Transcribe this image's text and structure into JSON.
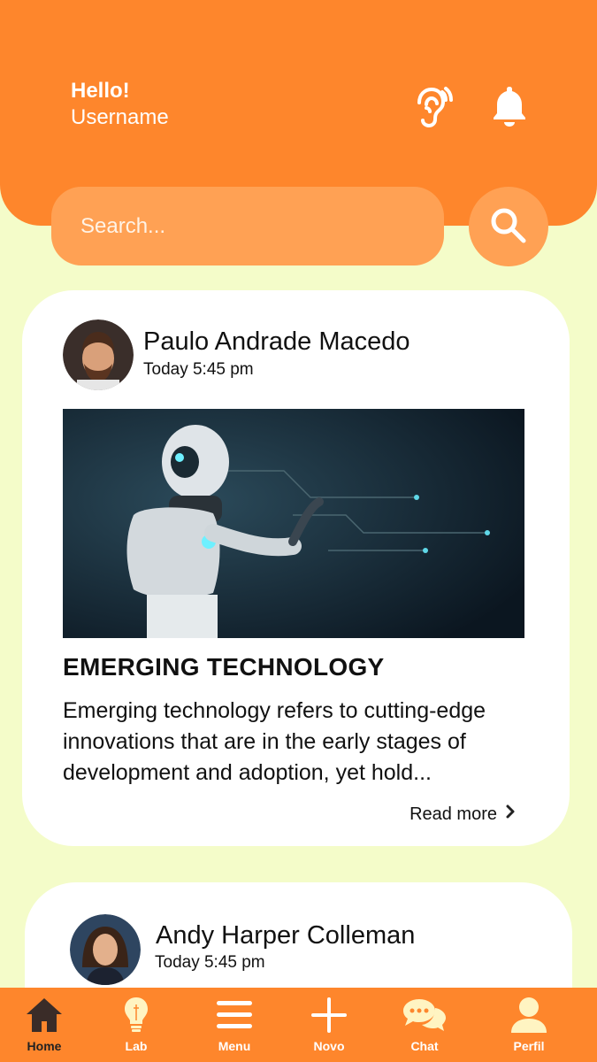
{
  "header": {
    "greeting": "Hello!",
    "username": "Username",
    "icons": [
      "ear-icon",
      "bell-icon"
    ]
  },
  "search": {
    "placeholder": "Search...",
    "icon": "search-icon"
  },
  "posts": [
    {
      "author": "Paulo Andrade Macedo",
      "time": "Today 5:45 pm",
      "title": "EMERGING TECHNOLOGY",
      "body": "Emerging technology refers to cutting-edge innovations that are in the early stages of development and adoption, yet hold...",
      "read_more": "Read more"
    },
    {
      "author": "Andy Harper Colleman",
      "time": "Today 5:45 pm"
    }
  ],
  "nav": [
    {
      "label": "Home",
      "icon": "home-icon",
      "active": true
    },
    {
      "label": "Lab",
      "icon": "lightbulb-icon",
      "active": false
    },
    {
      "label": "Menu",
      "icon": "menu-icon",
      "active": false
    },
    {
      "label": "Novo",
      "icon": "plus-icon",
      "active": false
    },
    {
      "label": "Chat",
      "icon": "chat-icon",
      "active": false
    },
    {
      "label": "Perfil",
      "icon": "user-icon",
      "active": false
    }
  ],
  "colors": {
    "primary": "#fe862c",
    "search_bg": "#ffa154",
    "background": "#f4fcc9",
    "card": "#ffffff"
  }
}
